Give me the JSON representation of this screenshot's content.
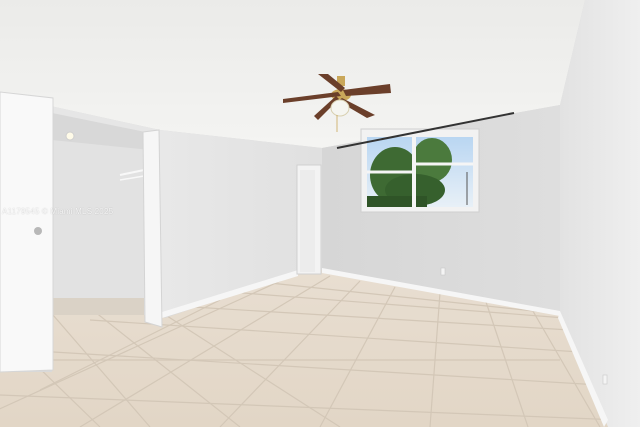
{
  "watermark": "A1179545 © Miami MLS 2025",
  "colors": {
    "ceiling": "#eeeeec",
    "wall_back": "#dcdcdc",
    "wall_left": "#e6e6e6",
    "wall_right": "#ececec",
    "floor_tile": "#e4d9cb",
    "grout": "#cfc4b5",
    "baseboard": "#f7f7f7",
    "door": "#f8f8f8",
    "fan_blade": "#6b3f2a",
    "fan_brass": "#c9a75a",
    "sky": "#cfe3f5",
    "tree": "#3f6b34"
  },
  "icons": [
    "ceiling-fan-icon",
    "tree-icon",
    "light-fixture-icon",
    "door-knob-icon",
    "outlet-icon"
  ]
}
